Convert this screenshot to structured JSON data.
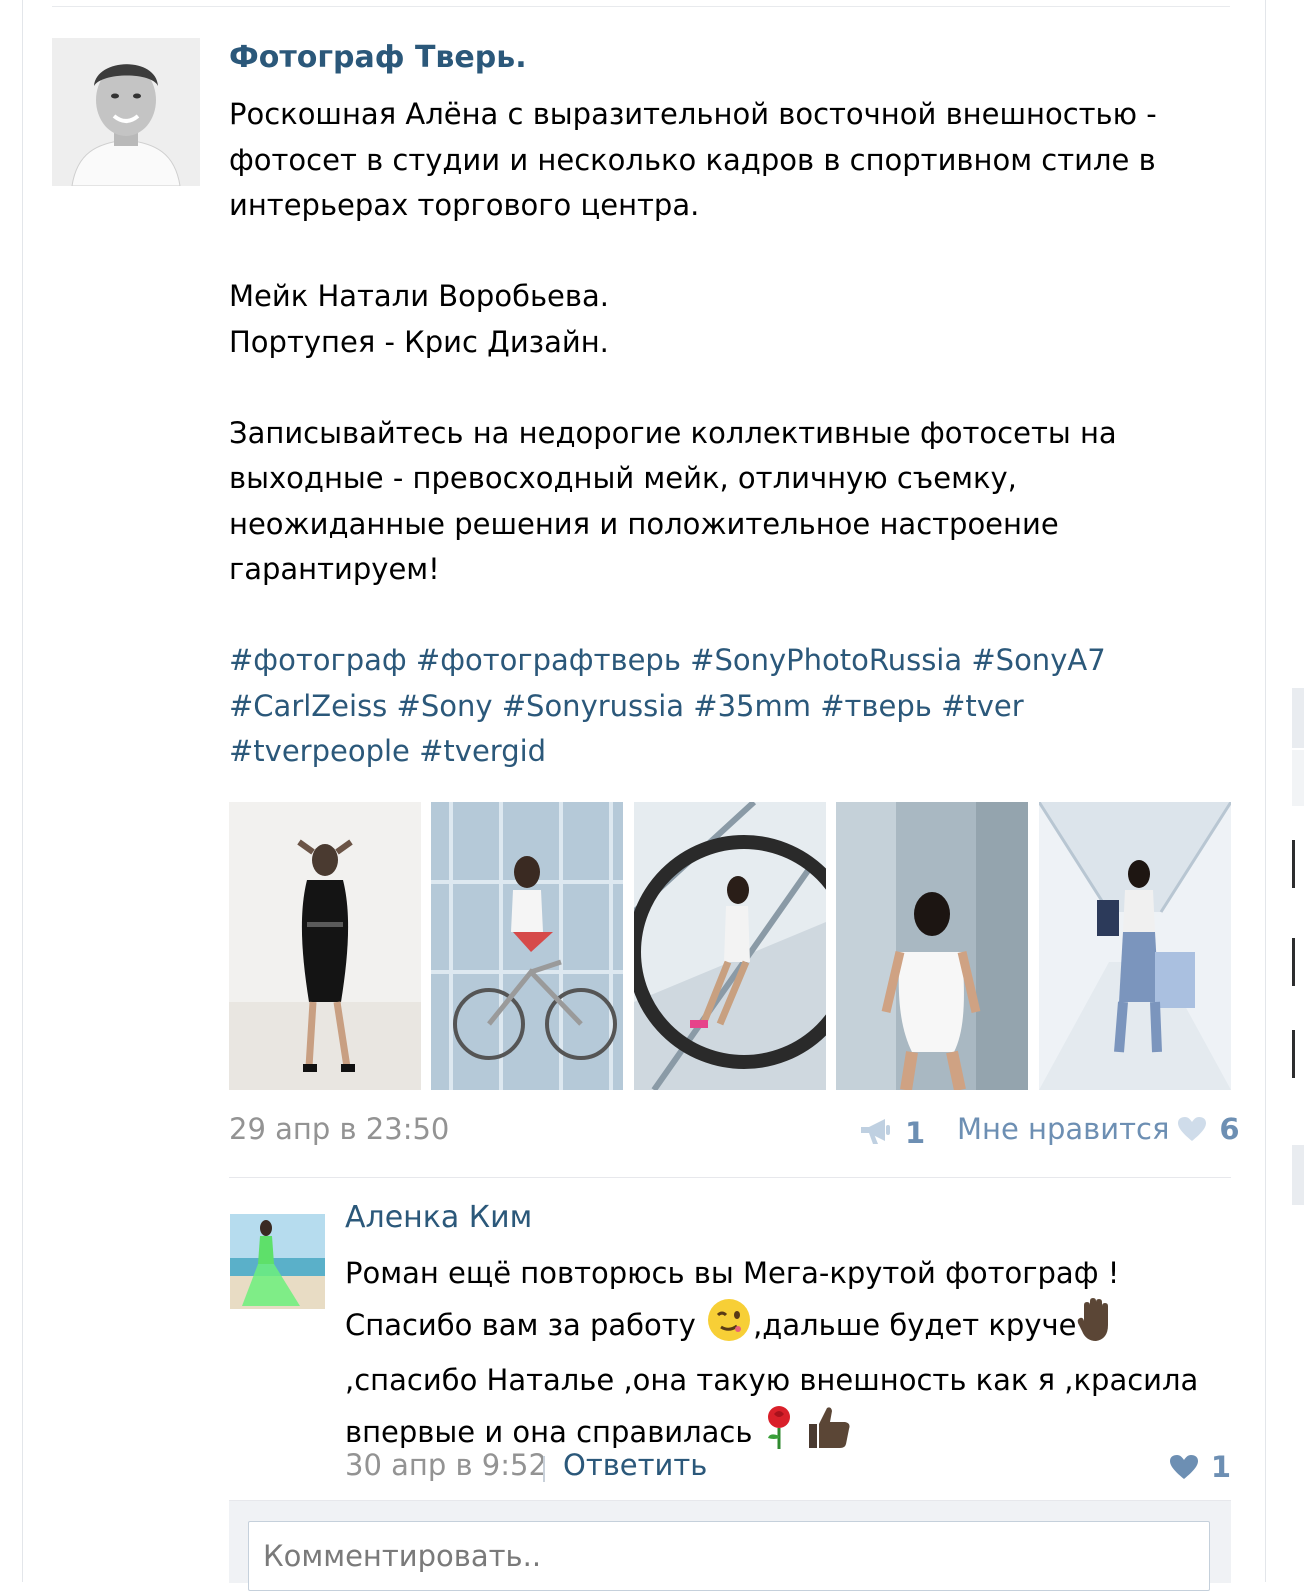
{
  "post": {
    "author": "Фотограф Тверь.",
    "paragraphs": [
      "Роскошная Алёна с выразительной восточной внешностью - фотосет в студии и несколько кадров в спортивном стиле в интерьерах торгового центра.",
      "",
      "Мейк Натали Воробьева.",
      "Портупея - Крис Дизайн.",
      "",
      "Записывайтесь на недорогие коллективные фотосеты на выходные - превосходный мейк, отличную съемку, неожиданные решения и положительное настроение гарантируем!"
    ],
    "hashtags": [
      "#фотограф",
      "#фотографтверь",
      "#SonyPhotoRussia",
      "#SonyA7",
      "#CarlZeiss",
      "#Sony",
      "#Sonyrussia",
      "#35mm",
      "#тверь",
      "#tver",
      "#tverpeople",
      "#tvergid"
    ],
    "date": "29 апр в 23:50",
    "share_count": "1",
    "like_label": "Мне нравится",
    "like_count": "6"
  },
  "comment": {
    "author": "Аленка Ким",
    "line1": "Роман ещё повторюсь вы Мега-крутой фотограф !",
    "line2a": "Спасибо вам за работу ",
    "line2b": ",дальше будет круче",
    "line3": ",спасибо Наталье ,она такую внешность как я ,красила",
    "line4": "впервые и она справилась ",
    "date": "30 апр в 9:52",
    "reply_label": "Ответить",
    "like_count": "1"
  },
  "comment_input": {
    "placeholder": "Комментировать.."
  },
  "colors": {
    "link": "#2b587a",
    "accent": "#6d8fb3",
    "meta": "#939393"
  },
  "icons": [
    "share-megaphone-icon",
    "heart-icon",
    "wink-emoji-icon",
    "raised-hand-emoji-icon",
    "rose-emoji-icon",
    "thumbs-up-emoji-icon"
  ]
}
